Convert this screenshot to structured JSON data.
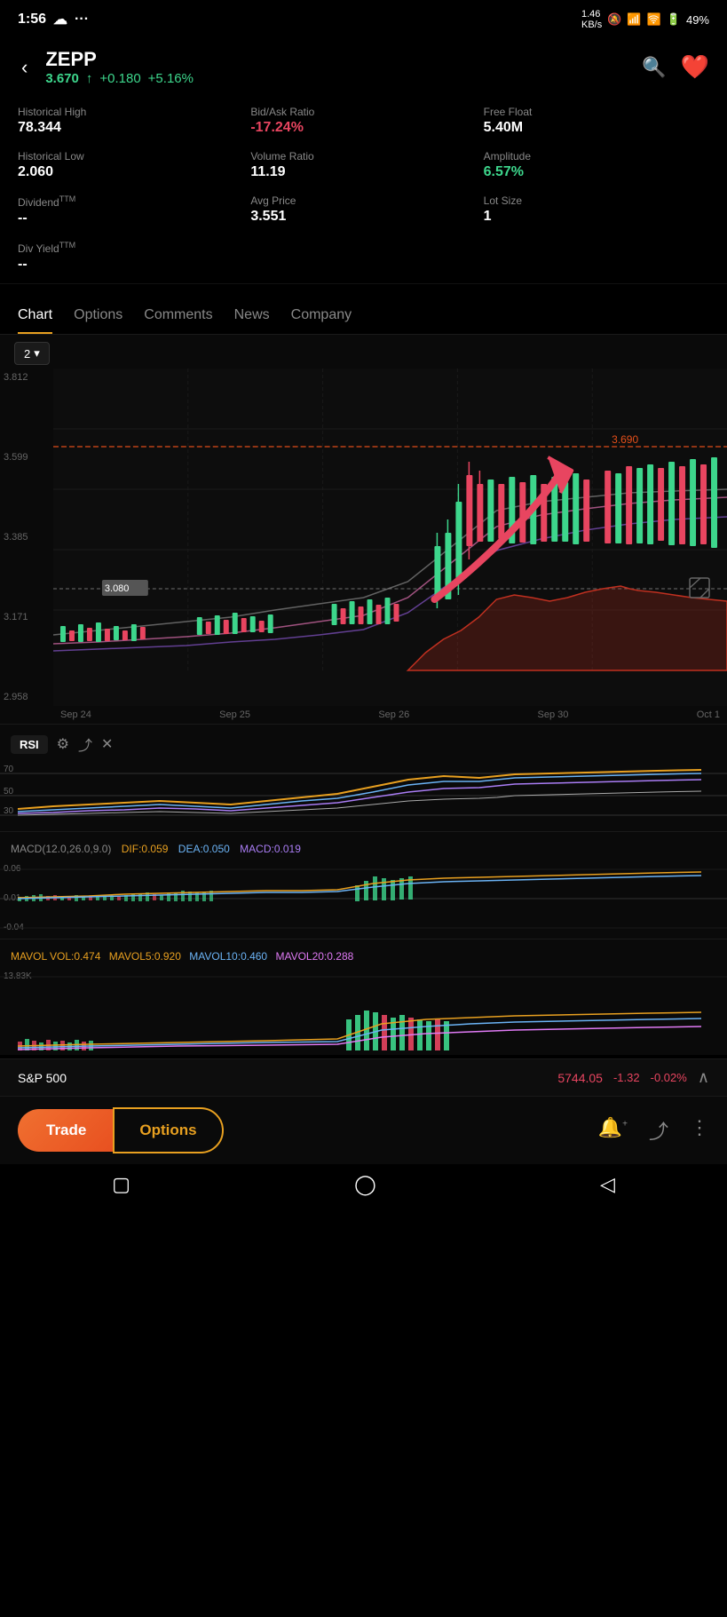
{
  "statusBar": {
    "time": "1:56",
    "battery": "49%",
    "signal": "···"
  },
  "header": {
    "ticker": "ZEPP",
    "price": "3.670",
    "change": "+0.180",
    "changePct": "+5.16%",
    "arrowUp": "↑"
  },
  "stats": {
    "historicalHigh": {
      "label": "Historical High",
      "value": "78.344"
    },
    "bidAskRatio": {
      "label": "Bid/Ask Ratio",
      "value": "-17.24%",
      "negative": true
    },
    "freeFloat": {
      "label": "Free Float",
      "value": "5.40M"
    },
    "historicalLow": {
      "label": "Historical Low",
      "value": "2.060"
    },
    "volumeRatio": {
      "label": "Volume Ratio",
      "value": "11.19"
    },
    "amplitude": {
      "label": "Amplitude",
      "value": "6.57%"
    },
    "dividend": {
      "label": "Dividend™",
      "value": "--"
    },
    "avgPrice": {
      "label": "Avg Price",
      "value": "3.551"
    },
    "lotSize": {
      "label": "Lot Size",
      "value": "1"
    },
    "divYield": {
      "label": "Div Yield™",
      "value": "--"
    }
  },
  "tabs": {
    "items": [
      "Chart",
      "Options",
      "Comments",
      "News",
      "Company"
    ],
    "active": 0
  },
  "chart": {
    "periodLabel": "2",
    "yLabels": [
      "3.812",
      "3.599",
      "3.385",
      "3.171",
      "2.958"
    ],
    "referencePrice": "3.690",
    "crosshairPrice": "3.080",
    "dateLabels": [
      "Sep 24",
      "Sep 25",
      "Sep 26",
      "Sep 30",
      "Oct 1"
    ]
  },
  "rsiPanel": {
    "label": "RSI",
    "levels": [
      "70",
      "50",
      "30"
    ]
  },
  "macdPanel": {
    "label": "MACD(12.0,26.0,9.0)",
    "dif": "DIF:0.059",
    "dea": "DEA:0.050",
    "macd": "MACD:0.019",
    "yLabels": [
      "0.06",
      "0.01",
      "-0.04"
    ]
  },
  "mavolPanel": {
    "label": "MAVOL",
    "vol": "VOL:0.474",
    "mavol5": "MAVOL5:0.920",
    "mavol10": "MAVOL10:0.460",
    "mavol20": "MAVOL20:0.288",
    "yLabel": "13.83K"
  },
  "bottomTicker": {
    "name": "S&P 500",
    "price": "5744.05",
    "change": "-1.32",
    "changePct": "-0.02%"
  },
  "bottomNav": {
    "tradeLabel": "Trade",
    "optionsLabel": "Options"
  }
}
